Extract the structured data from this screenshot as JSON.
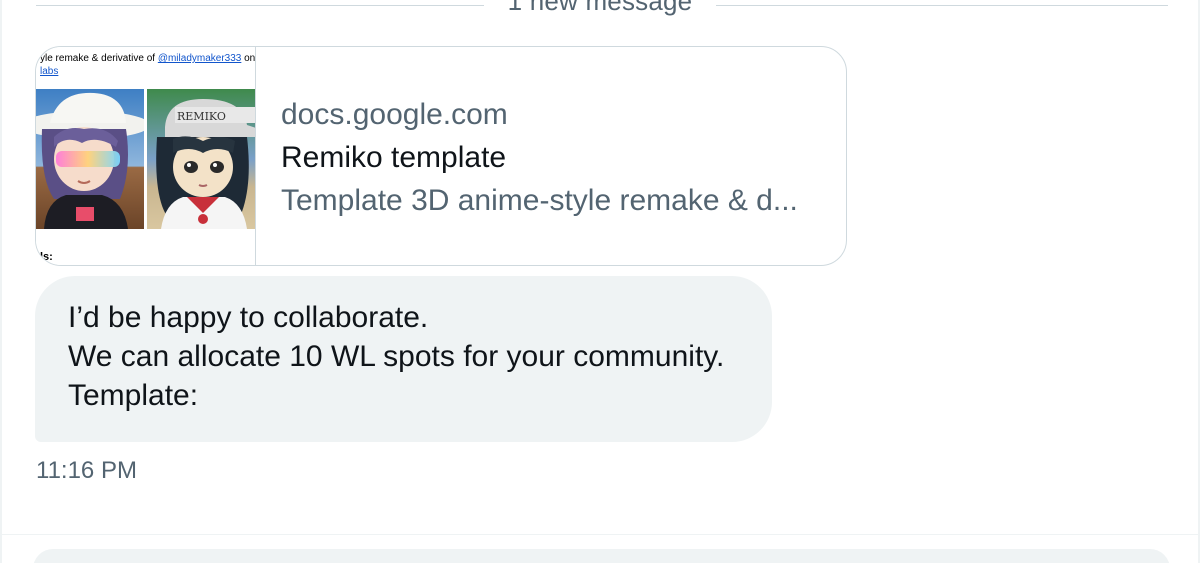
{
  "divider": {
    "label": "1 new message"
  },
  "link_card": {
    "thumbnail": {
      "line1_prefix": "yle remake & derivative of ",
      "line1_link": "@miladymaker333",
      "line1_suffix": " on",
      "line2": "labs",
      "line3": "ls:"
    },
    "domain": "docs.google.com",
    "title": "Remiko template",
    "description": "Template 3D anime-style remake & d..."
  },
  "message": {
    "lines": [
      "I’d be happy to collaborate.",
      "We can allocate 10 WL spots for your community.",
      "Template:"
    ],
    "timestamp": "11:16 PM"
  },
  "colors": {
    "bubble_bg": "#eff3f4",
    "secondary_text": "#536471",
    "primary_text": "#0f1419",
    "border": "#cfd9de",
    "link": "#1155cc"
  }
}
